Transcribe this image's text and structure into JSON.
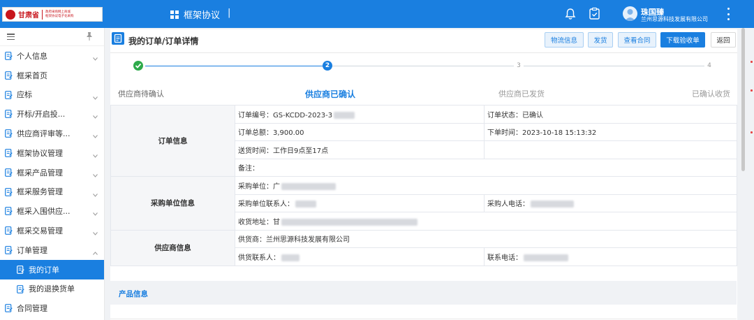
{
  "header": {
    "logo_name": "甘肃省",
    "logo_sub_line1": "政府采购网上商城",
    "logo_sub_line2": "框架协议电子化采购",
    "system_name": "框架协议",
    "system_sep": "|",
    "user_name": "珠国臻",
    "user_org": "兰州思源科技发展有限公司"
  },
  "sidebar": {
    "items": [
      {
        "label": "个人信息",
        "icon": "user-doc-icon",
        "chevron": "down"
      },
      {
        "label": "框采首页",
        "icon": "home-doc-icon",
        "chevron": ""
      },
      {
        "label": "应标",
        "icon": "bid-icon",
        "chevron": "down"
      },
      {
        "label": "开标/开启投...",
        "icon": "open-bid-icon",
        "chevron": "down"
      },
      {
        "label": "供应商评审等...",
        "icon": "review-icon",
        "chevron": "down"
      },
      {
        "label": "框架协议管理",
        "icon": "agreement-icon",
        "chevron": "down"
      },
      {
        "label": "框采产品管理",
        "icon": "product-icon",
        "chevron": "down"
      },
      {
        "label": "框采服务管理",
        "icon": "service-icon",
        "chevron": "down"
      },
      {
        "label": "框采入围供应...",
        "icon": "shortlist-icon",
        "chevron": "down"
      },
      {
        "label": "框采交易管理",
        "icon": "trade-icon",
        "chevron": "down"
      },
      {
        "label": "订单管理",
        "icon": "order-icon",
        "chevron": "up"
      }
    ],
    "subitems": [
      {
        "label": "我的订单",
        "icon": "order-list-icon",
        "active": true
      },
      {
        "label": "我的退换货单",
        "icon": "return-order-icon",
        "active": false
      }
    ],
    "last_item": "合同管理"
  },
  "page": {
    "title": "我的订单/订单详情",
    "buttons": {
      "logistics": "物流信息",
      "ship": "发货",
      "view_contract": "查看合同",
      "download_receipt": "下载验收单",
      "back": "返回"
    }
  },
  "steps": [
    {
      "number": "1",
      "label": "供应商待确认",
      "status": "done"
    },
    {
      "number": "2",
      "label": "供应商已确认",
      "status": "current"
    },
    {
      "number": "3",
      "label": "供应商已发货",
      "status": "pending"
    },
    {
      "number": "4",
      "label": "已确认收货",
      "status": "pending"
    }
  ],
  "order_info": {
    "section": "订单信息",
    "order_no_label": "订单编号：",
    "order_no_value": "GS-KCDD-2023-3",
    "status_label": "订单状态：",
    "status_value": "已确认",
    "total_label": "订单总额：",
    "total_value": "3,900.00",
    "order_time_label": "下单时间：",
    "order_time_value": "2023-10-18 15:13:32",
    "delivery_label": "送货时间：",
    "delivery_value": "工作日9点至17点",
    "remark_label": "备注："
  },
  "buyer_info": {
    "section": "采购单位信息",
    "unit_label": "采购单位：",
    "unit_value": "广",
    "contact_label": "采购单位联系人：",
    "contact_value": "",
    "phone_label": "采购人电话：",
    "phone_value": "",
    "address_label": "收货地址：",
    "address_value": "甘"
  },
  "supplier_info": {
    "section": "供应商信息",
    "supplier_label": "供货商：",
    "supplier_value": "兰州思源科技发展有限公司",
    "contact_label": "供货联系人：",
    "contact_value": "",
    "phone_label": "联系电话：",
    "phone_value": ""
  },
  "product_info": {
    "section": "产品信息"
  },
  "colors": {
    "primary": "#1a7fe0",
    "success": "#2eaa4b",
    "sidebar_active": "#1a7fe0"
  }
}
